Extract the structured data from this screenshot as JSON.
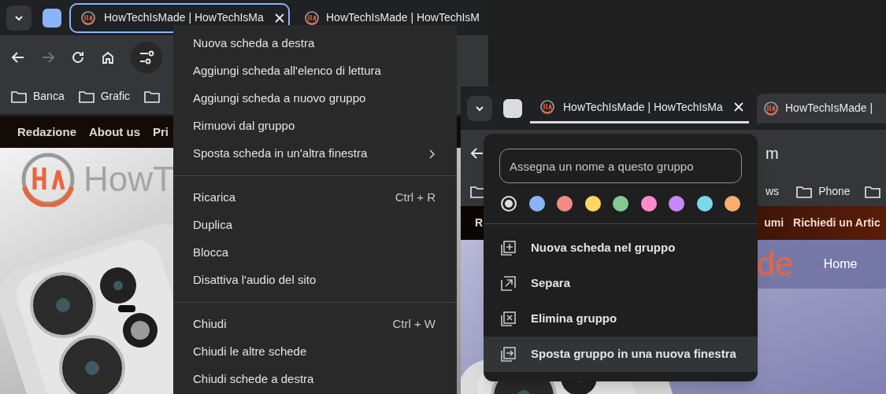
{
  "left_window": {
    "group_chip": {
      "color": "#8ab4f8"
    },
    "tabs": [
      {
        "title": "HowTechIsMade | HowTechIsMa",
        "selected": true,
        "in_group": true,
        "closable": true
      },
      {
        "title": "HowTechIsMade | HowTechIsM",
        "selected": false,
        "in_group": false
      }
    ],
    "toolbar": [
      {
        "kind": "back",
        "disabled": false
      },
      {
        "kind": "forward",
        "disabled": true
      },
      {
        "kind": "reload",
        "disabled": false
      },
      {
        "kind": "home",
        "disabled": false
      },
      {
        "kind": "site-info",
        "disabled": false
      }
    ],
    "bookmarks": [
      {
        "kind": "folder",
        "label": "Banca"
      },
      {
        "kind": "folder",
        "label": "Grafic"
      }
    ],
    "site_nav": [
      "Redazione",
      "About us",
      "Pri"
    ],
    "logo_text": "HowT",
    "context_menu": {
      "sections": [
        [
          {
            "label": "Nuova scheda a destra"
          },
          {
            "label": "Aggiungi scheda all'elenco di lettura"
          },
          {
            "label": "Aggiungi scheda a nuovo gruppo"
          },
          {
            "label": "Rimuovi dal gruppo"
          },
          {
            "label": "Sposta scheda in un'altra finestra",
            "submenu": true
          }
        ],
        [
          {
            "label": "Ricarica",
            "shortcut": "Ctrl + R"
          },
          {
            "label": "Duplica"
          },
          {
            "label": "Blocca"
          },
          {
            "label": "Disattiva l'audio del sito"
          }
        ],
        [
          {
            "label": "Chiudi",
            "shortcut": "Ctrl + W"
          },
          {
            "label": "Chiudi le altre schede"
          },
          {
            "label": "Chiudi schede a destra"
          }
        ]
      ]
    }
  },
  "right_window": {
    "group_chip": {
      "color": "#dadce0"
    },
    "tabs": [
      {
        "title": "HowTechIsMade | HowTechIsMa",
        "selected": false,
        "in_group": true,
        "closable": true
      },
      {
        "title": "HowTechIsMade |",
        "selected": true,
        "in_group": false
      }
    ],
    "address_text": "m",
    "bookmarks": [
      {
        "kind": "text",
        "label": "ws"
      },
      {
        "kind": "folder",
        "label": "Phone"
      }
    ],
    "site_nav": [
      "R",
      "umi",
      "Richiedi un Artic"
    ],
    "logo_text": "de",
    "page_link": "Home",
    "group_editor": {
      "name_field": {
        "placeholder": "Assegna un nome a questo gruppo"
      },
      "colors": [
        {
          "color": "#dadce0",
          "selected": true
        },
        {
          "color": "#8ab4f8",
          "selected": false
        },
        {
          "color": "#f28b82",
          "selected": false
        },
        {
          "color": "#fdd663",
          "selected": false
        },
        {
          "color": "#81c995",
          "selected": false
        },
        {
          "color": "#ff8bcb",
          "selected": false
        },
        {
          "color": "#c58af9",
          "selected": false
        },
        {
          "color": "#78d9ec",
          "selected": false
        },
        {
          "color": "#fcad70",
          "selected": false
        }
      ],
      "actions": [
        {
          "kind": "new-tab",
          "label": "Nuova scheda nel gruppo",
          "highlighted": false
        },
        {
          "kind": "ungroup",
          "label": "Separa",
          "highlighted": false
        },
        {
          "kind": "delete",
          "label": "Elimina gruppo",
          "highlighted": false
        },
        {
          "kind": "move",
          "label": "Sposta gruppo in una nuova finestra",
          "highlighted": true
        }
      ]
    }
  }
}
